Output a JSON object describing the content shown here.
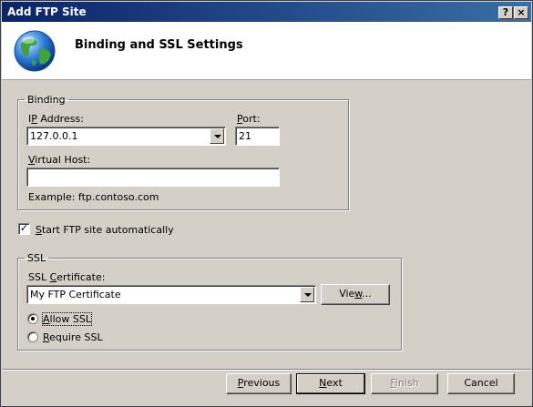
{
  "window": {
    "title": "Add FTP Site"
  },
  "title_buttons": {
    "help": "?",
    "close": "×"
  },
  "header": {
    "title": "Binding and SSL Settings",
    "icon": "globe-icon"
  },
  "binding": {
    "legend": "Binding",
    "ip_label_pre": "I",
    "ip_label_u": "P",
    "ip_label_post": " Address:",
    "ip_value": "127.0.0.1",
    "port_label_u": "P",
    "port_label_post": "ort:",
    "port_value": "21",
    "vhost_label_u": "V",
    "vhost_label_post": "irtual Host:",
    "vhost_value": "",
    "example": "Example: ftp.contoso.com"
  },
  "autostart": {
    "checked": true,
    "label_u": "S",
    "label_post": "tart FTP site automatically"
  },
  "ssl": {
    "legend": "SSL",
    "cert_label_pre": "SSL ",
    "cert_label_u": "C",
    "cert_label_post": "ertificate:",
    "cert_value": "My FTP Certificate",
    "view_pre": "Vie",
    "view_u": "w",
    "view_post": "...",
    "allow_u": "A",
    "allow_post": "llow SSL",
    "require_u": "R",
    "require_post": "equire SSL",
    "selected": "allow"
  },
  "footer": {
    "previous_u": "P",
    "previous_post": "revious",
    "next_u": "N",
    "next_post": "ext",
    "finish_u": "F",
    "finish_post": "inish",
    "cancel": "Cancel"
  }
}
